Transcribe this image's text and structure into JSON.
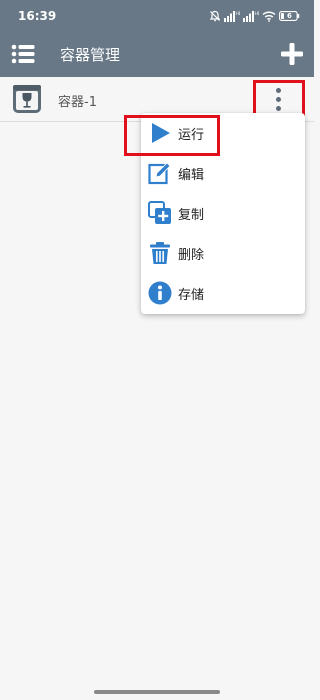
{
  "status_bar": {
    "time": "16:39",
    "battery_level": "6",
    "icons": [
      "mute-icon",
      "signal-hd-icon",
      "signal-hd-icon",
      "wifi-icon",
      "battery-icon"
    ]
  },
  "app_bar": {
    "title": "容器管理",
    "menu_icon": "list-menu-icon",
    "add_icon": "plus-icon"
  },
  "containers": [
    {
      "name": "容器-1",
      "icon": "wine-glass-box-icon"
    }
  ],
  "popup_menu": {
    "items": [
      {
        "label": "运行",
        "icon": "play-icon"
      },
      {
        "label": "编辑",
        "icon": "edit-icon"
      },
      {
        "label": "复制",
        "icon": "copy-icon"
      },
      {
        "label": "删除",
        "icon": "trash-icon"
      },
      {
        "label": "存储",
        "icon": "info-icon"
      }
    ]
  },
  "colors": {
    "app_bar": "#687887",
    "accent_blue": "#2f7fcd",
    "highlight_red": "#e0101d",
    "background": "#f6f6f6"
  }
}
